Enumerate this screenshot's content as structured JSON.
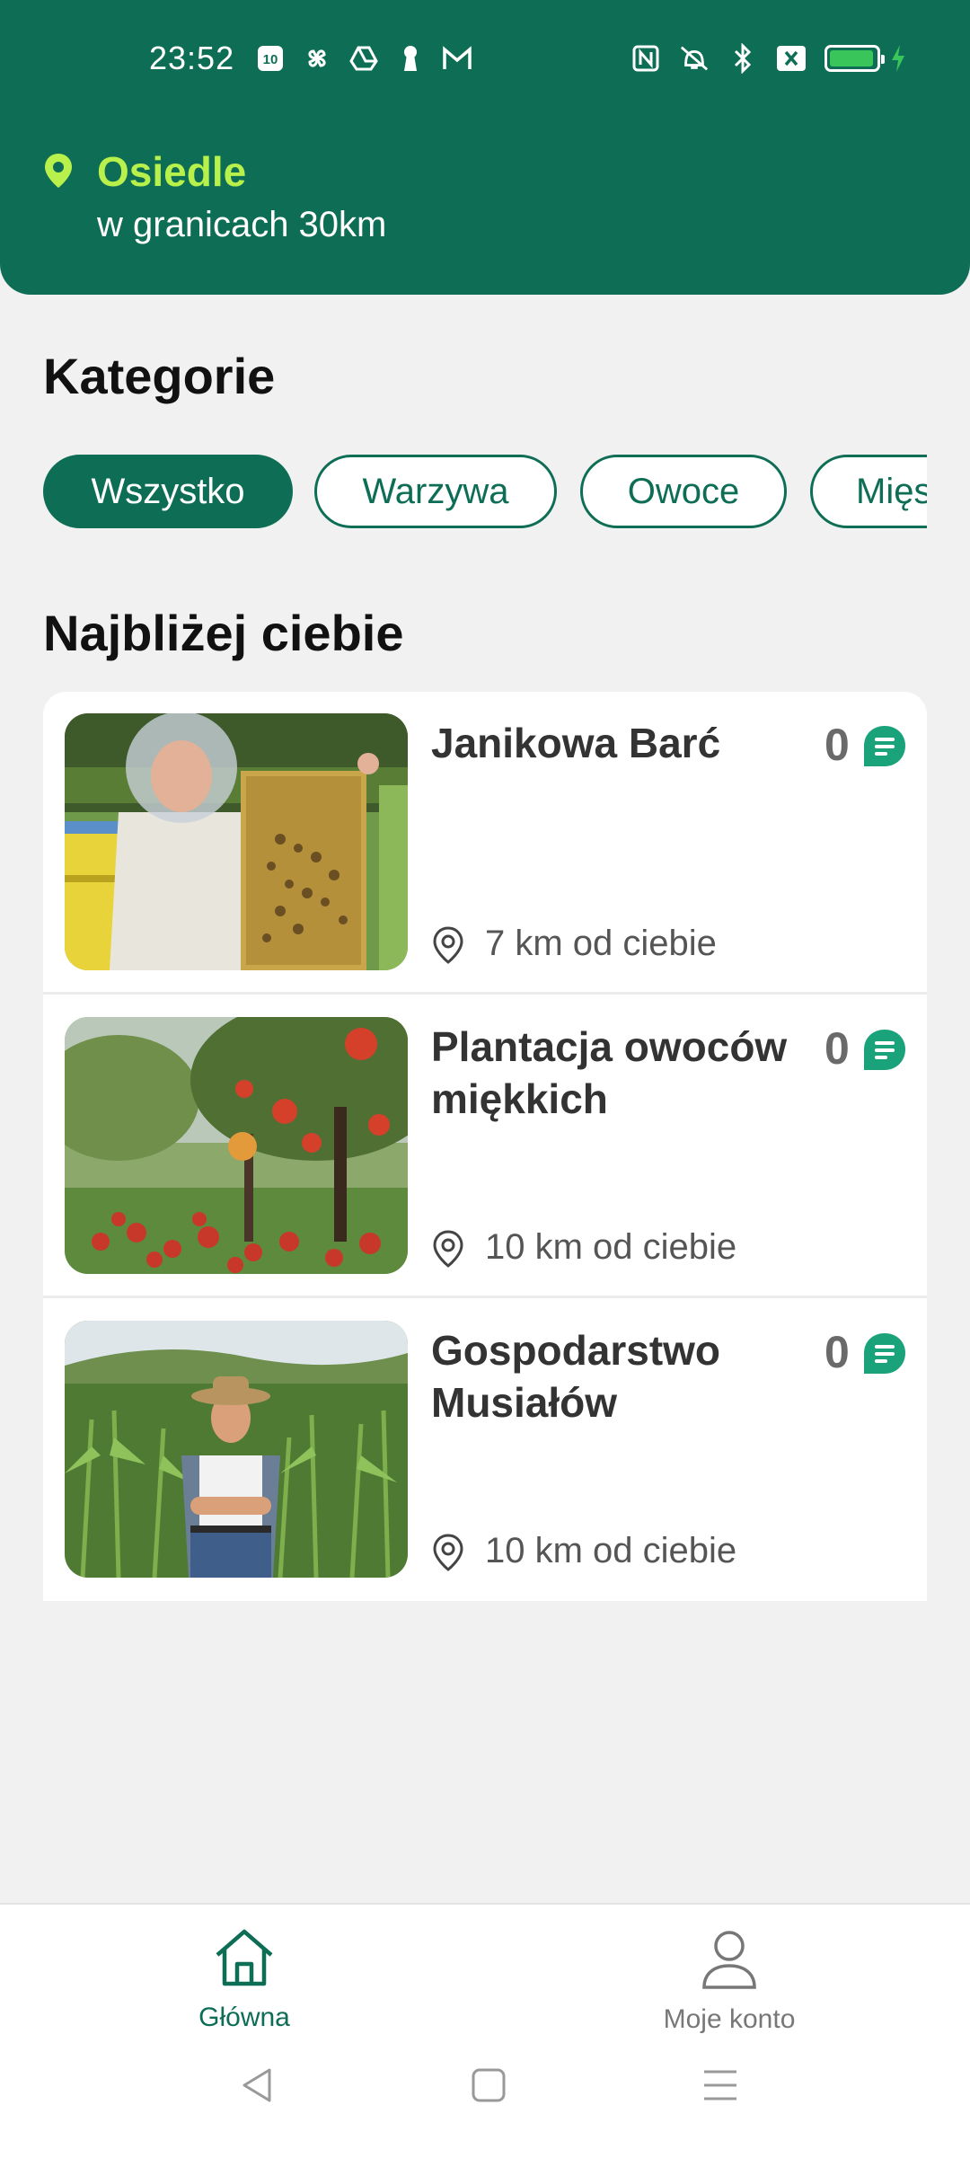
{
  "status_bar": {
    "time": "23:52",
    "left_icons": [
      "notification-10-icon",
      "pinwheel-icon",
      "drive-icon",
      "keyhole-icon",
      "gmail-icon"
    ],
    "right_icons": [
      "nfc-icon",
      "vibrate-off-icon",
      "bluetooth-icon",
      "sim-off-icon",
      "battery-icon",
      "charging-icon"
    ],
    "battery_level": 0.9
  },
  "location": {
    "title": "Osiedle",
    "subtitle": "w granicach 30km"
  },
  "categories": {
    "title": "Kategorie",
    "chips": [
      {
        "label": "Wszystko",
        "active": true
      },
      {
        "label": "Warzywa",
        "active": false
      },
      {
        "label": "Owoce",
        "active": false
      },
      {
        "label": "Mięso",
        "active": false
      }
    ]
  },
  "nearby": {
    "title": "Najbliżej ciebie",
    "items": [
      {
        "name": "Janikowa Barć",
        "count": "0",
        "distance": "7 km od ciebie",
        "image": "beekeeper-photo"
      },
      {
        "name": "Plantacja owoców miękkich",
        "count": "0",
        "distance": "10 km od ciebie",
        "image": "apple-orchard-photo"
      },
      {
        "name": "Gospodarstwo Musiałów",
        "count": "0",
        "distance": "10 km od ciebie",
        "image": "farmer-cornfield-photo"
      }
    ]
  },
  "bottom_nav": {
    "items": [
      {
        "label": "Główna",
        "icon": "home-icon",
        "active": true
      },
      {
        "label": "Moje konto",
        "icon": "user-icon",
        "active": false
      }
    ]
  },
  "colors": {
    "primary": "#0e6e55",
    "accent": "#b8f04c",
    "chat_badge": "#1aa37a"
  }
}
